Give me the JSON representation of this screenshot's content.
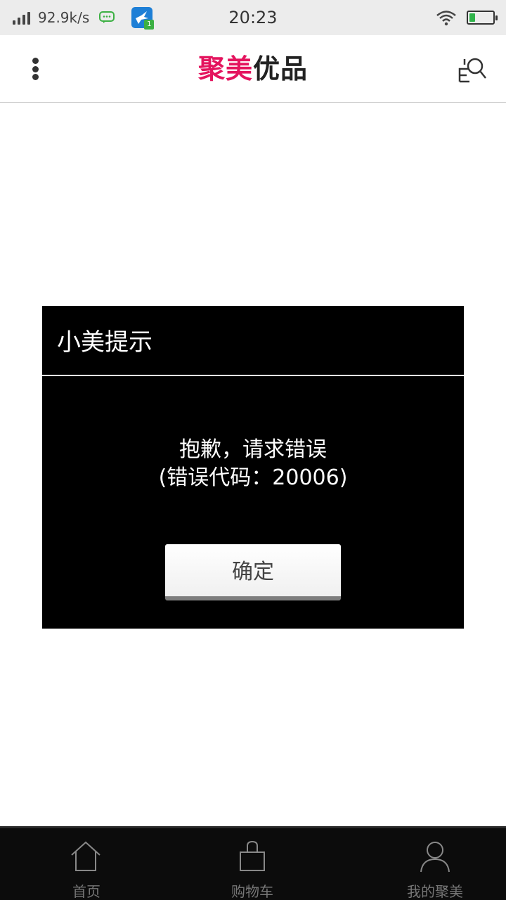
{
  "status_bar": {
    "net_speed": "92.9k/s",
    "time": "20:23",
    "app_badge_count": "1",
    "battery_level": 0.25
  },
  "header": {
    "logo_part1": "聚美",
    "logo_part2": "优品",
    "logo_part1_color": "#e4145e"
  },
  "dialog": {
    "title": "小美提示",
    "message_line1": "抱歉，请求错误",
    "message_line2": "(错误代码：20006)",
    "confirm_label": "确定"
  },
  "bottom_nav": {
    "items": [
      {
        "label": "首页",
        "icon": "home-icon"
      },
      {
        "label": "购物车",
        "icon": "shopping-bag-icon"
      },
      {
        "label": "我的聚美",
        "icon": "user-icon"
      }
    ]
  }
}
